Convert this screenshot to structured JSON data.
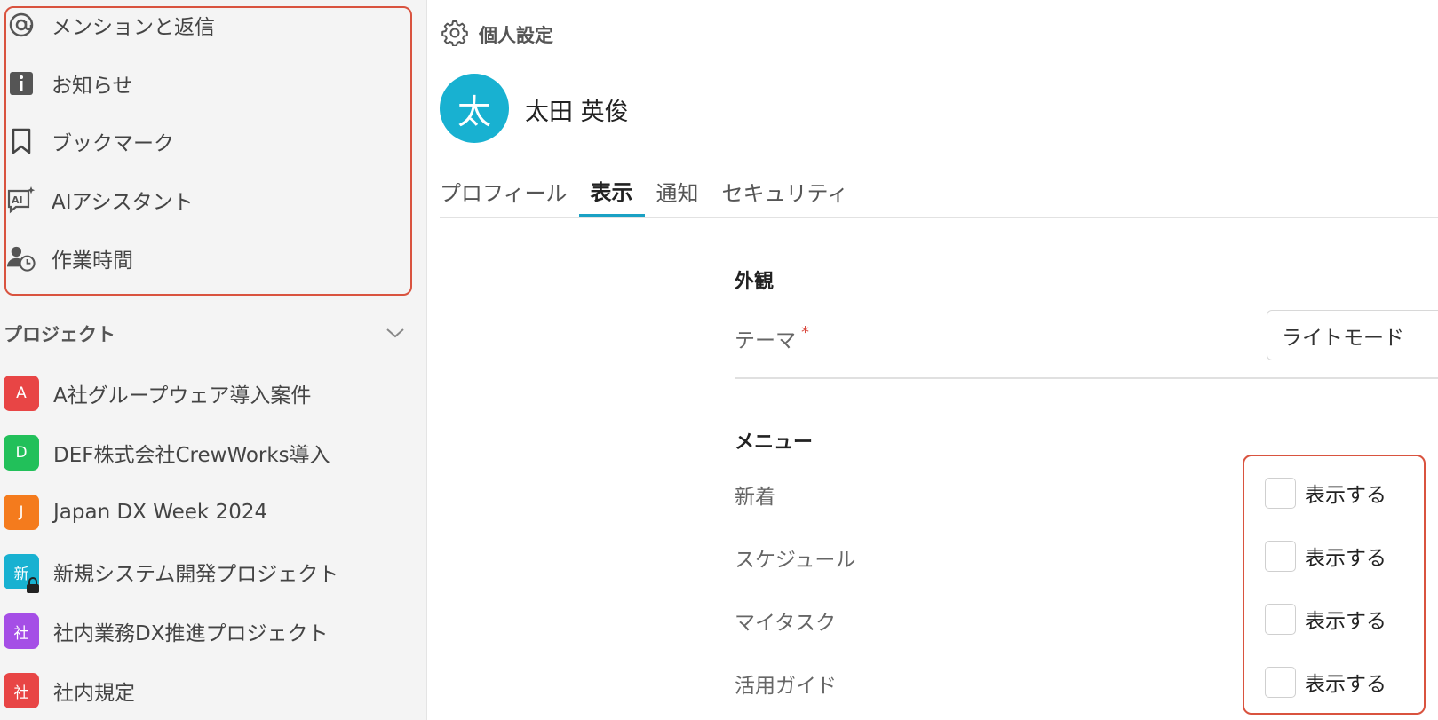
{
  "sidebar": {
    "nav": [
      {
        "label": "メンションと返信",
        "icon": "at-icon"
      },
      {
        "label": "お知らせ",
        "icon": "info-icon"
      },
      {
        "label": "ブックマーク",
        "icon": "bookmark-icon"
      },
      {
        "label": "AIアシスタント",
        "icon": "ai-assistant-icon"
      },
      {
        "label": "作業時間",
        "icon": "user-clock-icon"
      }
    ],
    "projects_title": "プロジェクト",
    "projects": [
      {
        "badge": "A",
        "label": "A社グループウェア導入案件",
        "color": "#e84545",
        "locked": false
      },
      {
        "badge": "D",
        "label": "DEF株式会社CrewWorks導入",
        "color": "#22c05a",
        "locked": false
      },
      {
        "badge": "J",
        "label": "Japan DX Week 2024",
        "color": "#f47b1d",
        "locked": false
      },
      {
        "badge": "新",
        "label": "新規システム開発プロジェクト",
        "color": "#18b1d1",
        "locked": true
      },
      {
        "badge": "社",
        "label": "社内業務DX推進プロジェクト",
        "color": "#a54ee6",
        "locked": false
      },
      {
        "badge": "社",
        "label": "社内規定",
        "color": "#e84545",
        "locked": false
      }
    ]
  },
  "main": {
    "title": "個人設定",
    "user": {
      "avatar": "太",
      "name": "太田 英俊"
    },
    "tabs": [
      {
        "label": "プロフィール",
        "active": false
      },
      {
        "label": "表示",
        "active": true
      },
      {
        "label": "通知",
        "active": false
      },
      {
        "label": "セキュリティ",
        "active": false
      }
    ],
    "appearance": {
      "title": "外観",
      "theme_label": "テーマ",
      "required_mark": "*",
      "theme_value": "ライトモード"
    },
    "menu": {
      "title": "メニュー",
      "items": [
        {
          "label": "新着",
          "option": "表示する",
          "checked": false
        },
        {
          "label": "スケジュール",
          "option": "表示する",
          "checked": false
        },
        {
          "label": "マイタスク",
          "option": "表示する",
          "checked": false
        },
        {
          "label": "活用ガイド",
          "option": "表示する",
          "checked": false
        }
      ]
    }
  },
  "colors": {
    "accent": "#1aa1c4",
    "highlight": "#d9533f",
    "avatar": "#18b1d1"
  }
}
